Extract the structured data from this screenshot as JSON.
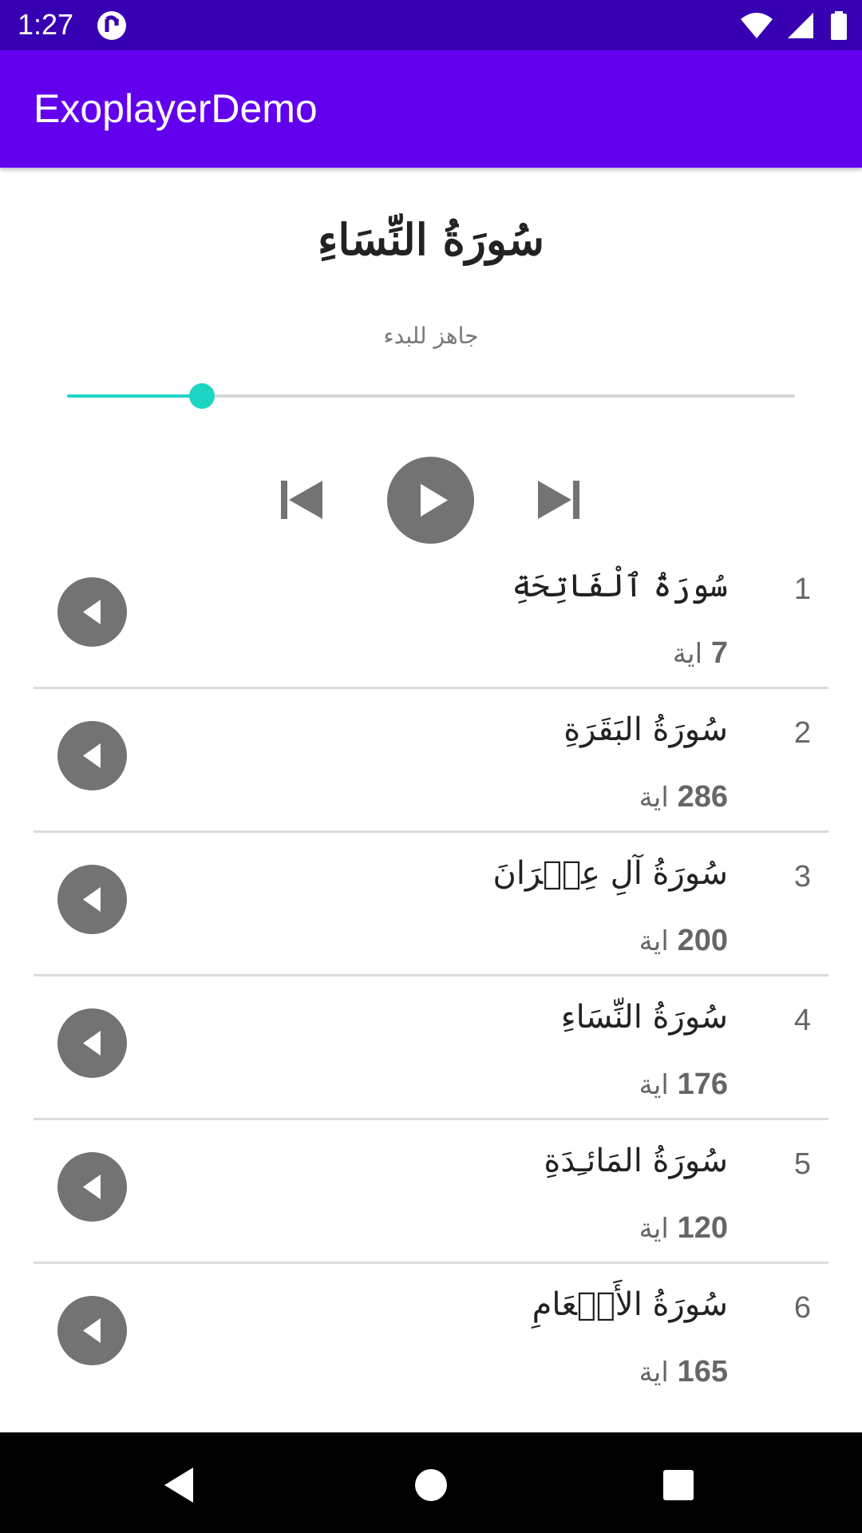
{
  "status_bar": {
    "time": "1:27",
    "icons": [
      "app-notification-icon",
      "wifi-icon",
      "signal-icon",
      "battery-icon"
    ]
  },
  "app_bar": {
    "title": "ExoplayerDemo",
    "color": "#6200ee"
  },
  "player": {
    "now_playing": "سُورَةُ النِّسَاءِ",
    "status": "جاهز للبدء",
    "progress_fraction": 0.185,
    "accent_color": "#1dd5c4",
    "controls": [
      "previous-icon",
      "play-icon",
      "next-icon"
    ]
  },
  "surahs": [
    {
      "number": "1",
      "name": "سُورَةُ ٱلْفَاتِحَةِ",
      "ayat_count": "7",
      "ayat_label": "اية"
    },
    {
      "number": "2",
      "name": "سُورَةُ البَقَرَةِ",
      "ayat_count": "286",
      "ayat_label": "اية"
    },
    {
      "number": "3",
      "name": "سُورَةُ آلِ عِمۡرَانَ",
      "ayat_count": "200",
      "ayat_label": "اية"
    },
    {
      "number": "4",
      "name": "سُورَةُ النِّسَاءِ",
      "ayat_count": "176",
      "ayat_label": "اية"
    },
    {
      "number": "5",
      "name": "سُورَةُ المَائـِدَةِ",
      "ayat_count": "120",
      "ayat_label": "اية"
    },
    {
      "number": "6",
      "name": "سُورَةُ الأَنۡعَامِ",
      "ayat_count": "165",
      "ayat_label": "اية"
    }
  ],
  "nav_bar": {
    "icons": [
      "back-icon",
      "home-icon",
      "recents-icon"
    ]
  }
}
